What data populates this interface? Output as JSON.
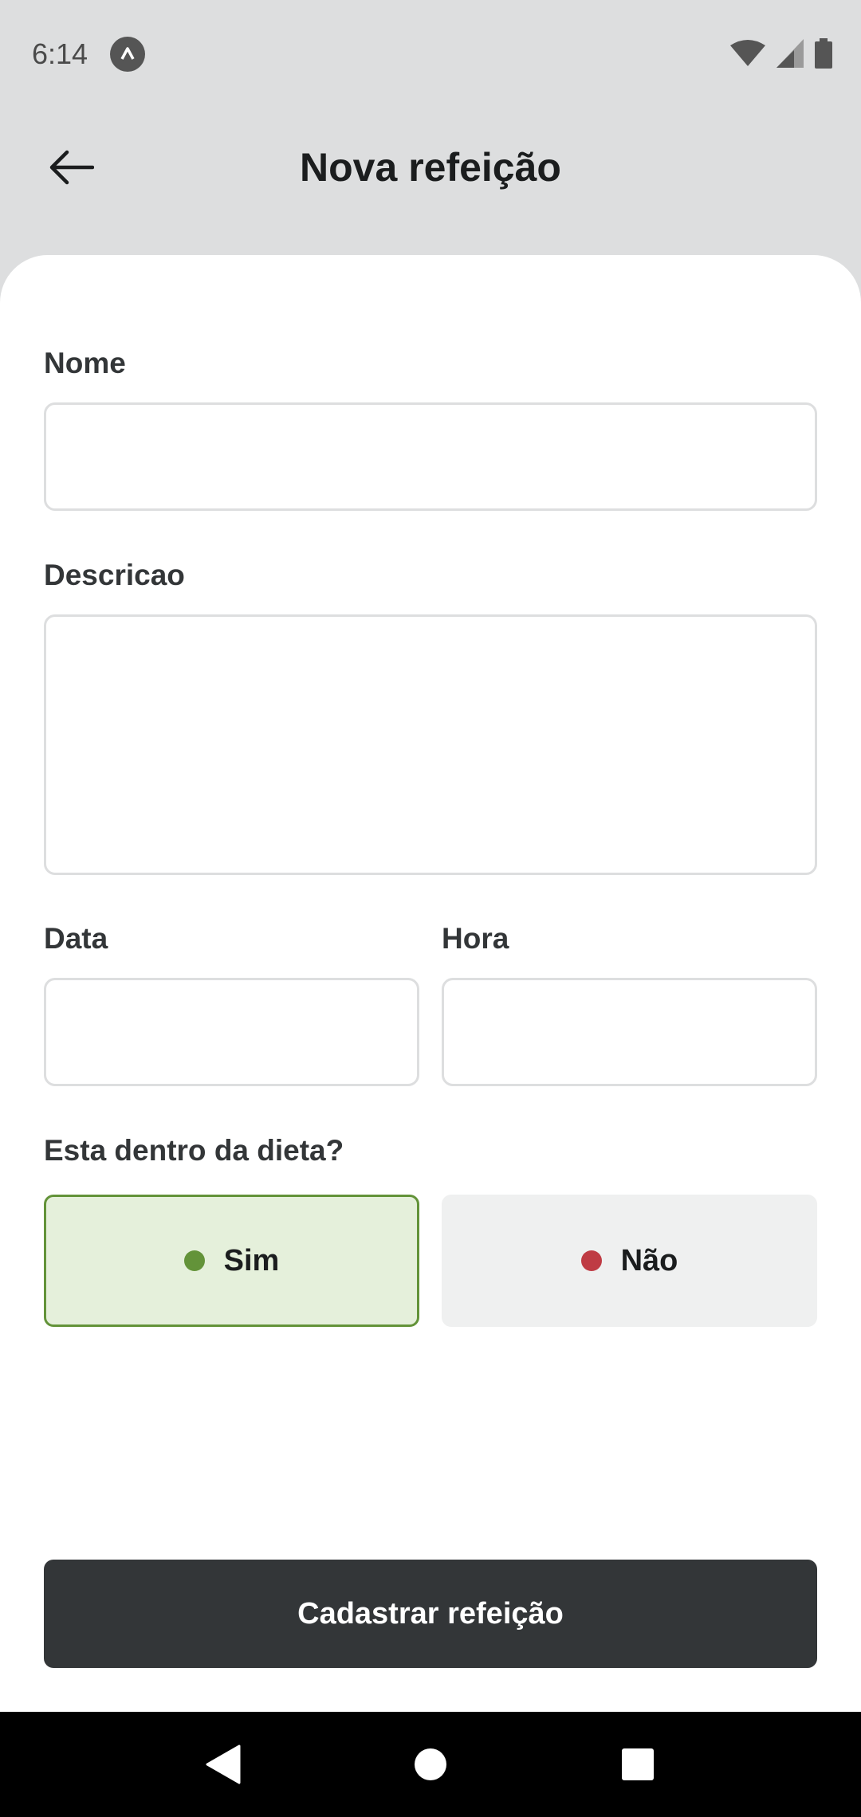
{
  "status_bar": {
    "time": "6:14",
    "icons": [
      "app-notification-icon",
      "wifi-icon",
      "signal-icon",
      "battery-icon"
    ]
  },
  "header": {
    "title": "Nova refeição",
    "back_icon": "arrow-left-icon"
  },
  "form": {
    "name": {
      "label": "Nome",
      "value": ""
    },
    "description": {
      "label": "Descricao",
      "value": ""
    },
    "date": {
      "label": "Data",
      "value": ""
    },
    "time": {
      "label": "Hora",
      "value": ""
    },
    "diet": {
      "label": "Esta dentro da dieta?",
      "options": [
        {
          "label": "Sim",
          "selected": true,
          "dot_color": "#639339"
        },
        {
          "label": "Não",
          "selected": false,
          "dot_color": "#BF3B44"
        }
      ]
    },
    "submit_label": "Cadastrar refeição"
  },
  "colors": {
    "background": "#DDDEDF",
    "button_dark": "#333638",
    "yes_bg": "#E5F0DB",
    "yes_border": "#639339",
    "no_bg": "#EFF0F0"
  },
  "nav_bar": {
    "icons": [
      "back-triangle-icon",
      "home-circle-icon",
      "recents-square-icon"
    ]
  }
}
